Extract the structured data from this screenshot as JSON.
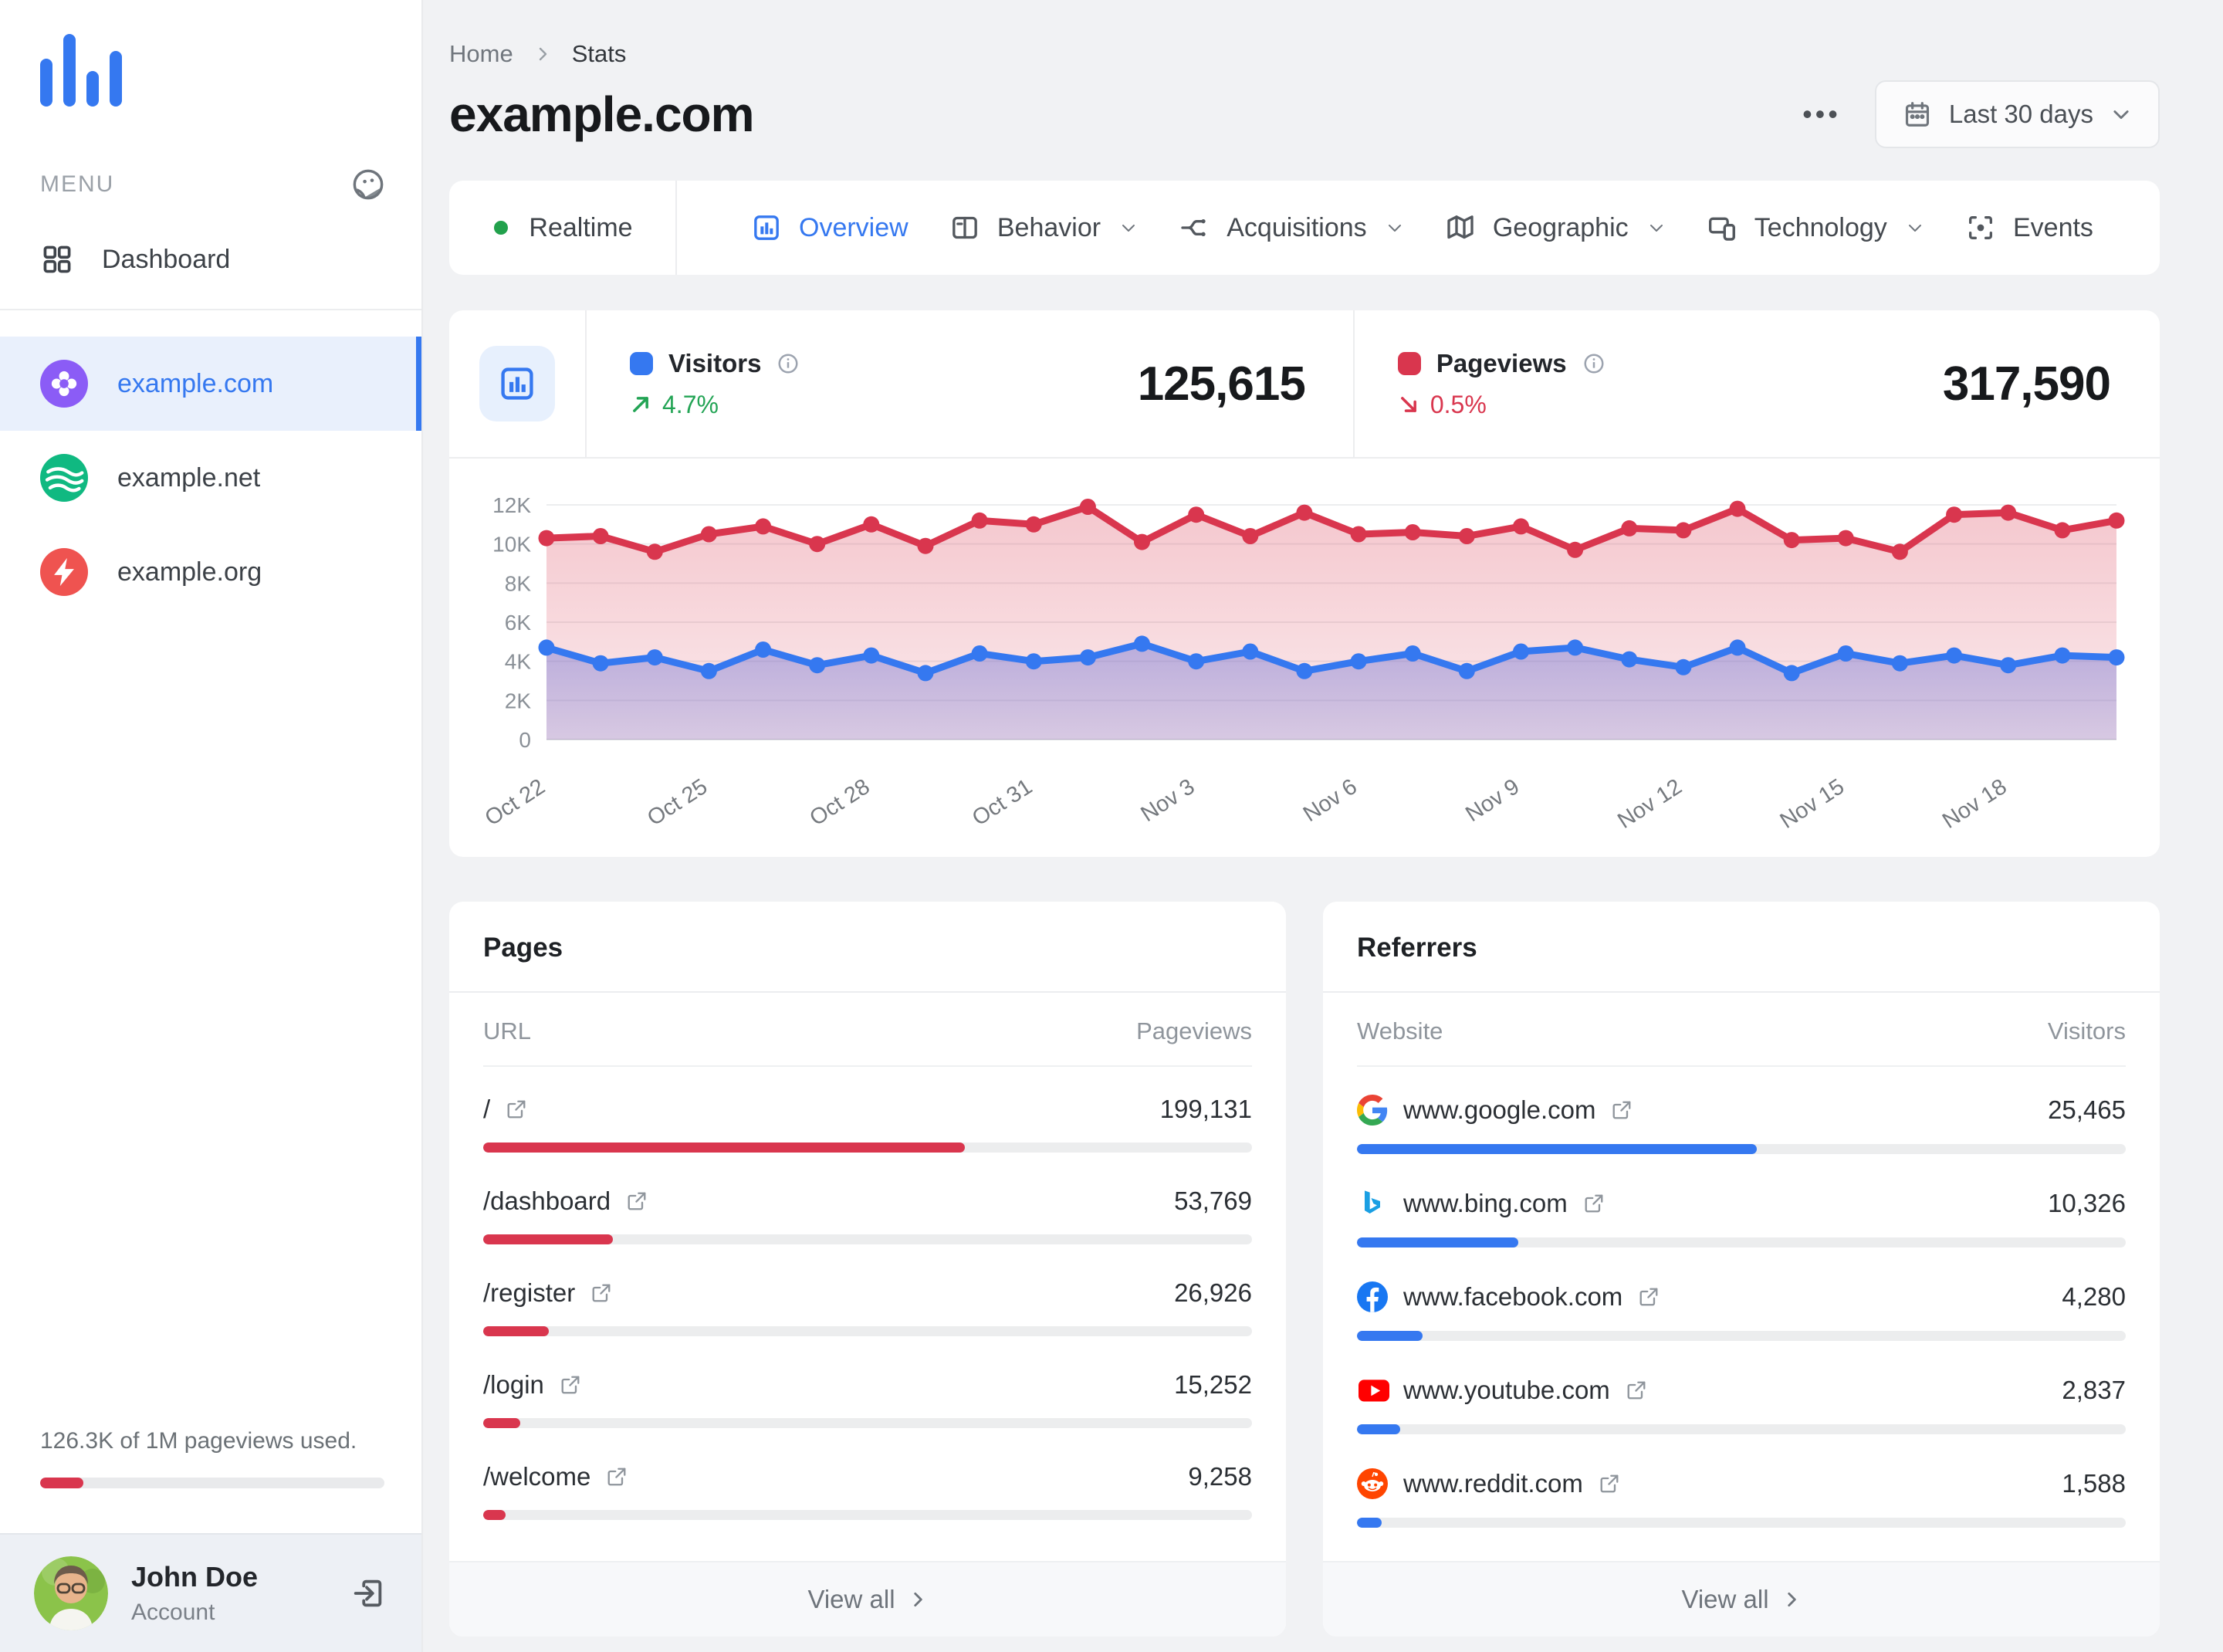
{
  "app": {
    "accent_blue": "#3578F0",
    "accent_red": "#D9364E",
    "accent_green": "#23A455"
  },
  "sidebar": {
    "logo_icon": "bar-chart-logo",
    "menu_label": "MENU",
    "theme_icon": "theme-face-icon",
    "dashboard": {
      "label": "Dashboard",
      "icon": "grid-icon"
    },
    "sites": [
      {
        "label": "example.com",
        "icon": "clover-site-icon",
        "icon_bg": "#8B5CF6",
        "active": true
      },
      {
        "label": "example.net",
        "icon": "waves-site-icon",
        "icon_bg": "#10B981",
        "active": false
      },
      {
        "label": "example.org",
        "icon": "bolt-site-icon",
        "icon_bg": "#EF5350",
        "active": false
      }
    ],
    "usage": {
      "text": "126.3K of 1M pageviews used.",
      "percent": 12.6,
      "bar_color": "#D9364E"
    },
    "user": {
      "name": "John Doe",
      "role": "Account",
      "logout_icon": "logout-icon"
    }
  },
  "header": {
    "breadcrumb": {
      "home": "Home",
      "current": "Stats"
    },
    "title": "example.com",
    "more_label": "•••",
    "date_range": "Last 30 days",
    "date_icon": "calendar-icon"
  },
  "tabs": [
    {
      "label": "Realtime",
      "icon": "realtime-dot-icon",
      "type": "realtime",
      "active": false,
      "chevron": false
    },
    {
      "label": "Overview",
      "icon": "overview-icon",
      "type": "tab",
      "active": true,
      "chevron": false
    },
    {
      "label": "Behavior",
      "icon": "behavior-icon",
      "type": "tab",
      "active": false,
      "chevron": true
    },
    {
      "label": "Acquisitions",
      "icon": "acquisitions-icon",
      "type": "tab",
      "active": false,
      "chevron": true
    },
    {
      "label": "Geographic",
      "icon": "geographic-icon",
      "type": "tab",
      "active": false,
      "chevron": true
    },
    {
      "label": "Technology",
      "icon": "technology-icon",
      "type": "tab",
      "active": false,
      "chevron": true
    },
    {
      "label": "Events",
      "icon": "events-icon",
      "type": "tab",
      "active": false,
      "chevron": false
    }
  ],
  "stats": {
    "box_icon": "bar-chart-icon",
    "visitors": {
      "label": "Visitors",
      "value": "125,615",
      "change": "4.7%",
      "direction": "up",
      "color": "#3578F0"
    },
    "pageviews": {
      "label": "Pageviews",
      "value": "317,590",
      "change": "0.5%",
      "direction": "down",
      "color": "#D9364E"
    }
  },
  "chart_data": {
    "type": "area",
    "title": "Visitors and pageviews over last 30 days",
    "x": [
      "Oct 22",
      "Oct 23",
      "Oct 24",
      "Oct 25",
      "Oct 26",
      "Oct 27",
      "Oct 28",
      "Oct 29",
      "Oct 30",
      "Oct 31",
      "Nov 1",
      "Nov 2",
      "Nov 3",
      "Nov 4",
      "Nov 5",
      "Nov 6",
      "Nov 7",
      "Nov 8",
      "Nov 9",
      "Nov 10",
      "Nov 11",
      "Nov 12",
      "Nov 13",
      "Nov 14",
      "Nov 15",
      "Nov 16",
      "Nov 17",
      "Nov 18",
      "Nov 19",
      "Nov 20"
    ],
    "tick_every": 3,
    "ylim": [
      0,
      12000
    ],
    "yticks": [
      "0",
      "2K",
      "4K",
      "6K",
      "8K",
      "10K",
      "12K"
    ],
    "grid": true,
    "legend_position": "top-stats-row",
    "series": [
      {
        "name": "Pageviews",
        "color": "#D9364E",
        "values": [
          10300,
          10400,
          9600,
          10500,
          10900,
          10000,
          11000,
          9900,
          11200,
          11000,
          11900,
          10100,
          11500,
          10400,
          11600,
          10500,
          10600,
          10400,
          10900,
          9700,
          10800,
          10700,
          11800,
          10200,
          10300,
          9600,
          11500,
          11600,
          10700,
          11200
        ]
      },
      {
        "name": "Visitors",
        "color": "#3578F0",
        "values": [
          4700,
          3900,
          4200,
          3500,
          4600,
          3800,
          4300,
          3400,
          4400,
          4000,
          4200,
          4900,
          4000,
          4500,
          3500,
          4000,
          4400,
          3500,
          4500,
          4700,
          4100,
          3700,
          4700,
          3400,
          4400,
          3900,
          4300,
          3800,
          4300,
          4200
        ]
      }
    ]
  },
  "pages": {
    "title": "Pages",
    "col_key": "URL",
    "col_value": "Pageviews",
    "view_all": "View all",
    "bar_color": "#D9364E",
    "rows": [
      {
        "label": "/",
        "value": "199,131",
        "percent": 62.7
      },
      {
        "label": "/dashboard",
        "value": "53,769",
        "percent": 16.9
      },
      {
        "label": "/register",
        "value": "26,926",
        "percent": 8.5
      },
      {
        "label": "/login",
        "value": "15,252",
        "percent": 4.8
      },
      {
        "label": "/welcome",
        "value": "9,258",
        "percent": 2.9
      }
    ]
  },
  "referrers": {
    "title": "Referrers",
    "col_key": "Website",
    "col_value": "Visitors",
    "view_all": "View all",
    "bar_color": "#3578F0",
    "rows": [
      {
        "label": "www.google.com",
        "value": "25,465",
        "percent": 52,
        "icon": "google-favicon"
      },
      {
        "label": "www.bing.com",
        "value": "10,326",
        "percent": 21,
        "icon": "bing-favicon"
      },
      {
        "label": "www.facebook.com",
        "value": "4,280",
        "percent": 8.5,
        "icon": "facebook-favicon"
      },
      {
        "label": "www.youtube.com",
        "value": "2,837",
        "percent": 5.6,
        "icon": "youtube-favicon"
      },
      {
        "label": "www.reddit.com",
        "value": "1,588",
        "percent": 3.2,
        "icon": "reddit-favicon"
      }
    ]
  }
}
